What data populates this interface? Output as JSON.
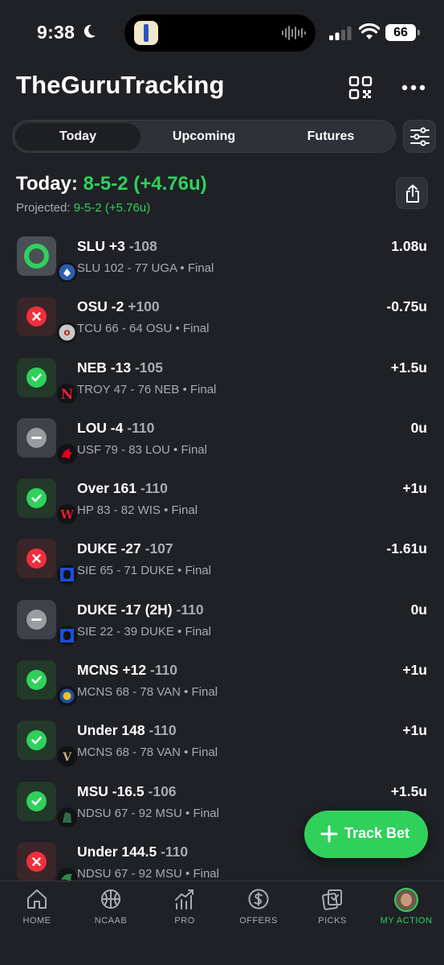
{
  "status_bar": {
    "time": "9:38",
    "battery": "66"
  },
  "header": {
    "title": "TheGuruTracking"
  },
  "tabs": [
    {
      "label": "Today",
      "active": true
    },
    {
      "label": "Upcoming",
      "active": false
    },
    {
      "label": "Futures",
      "active": false
    }
  ],
  "summary": {
    "today_label": "Today:",
    "today_record": "8-5-2 (+4.76u)",
    "projected_label": "Projected:",
    "projected_record": "9-5-2 (+5.76u)"
  },
  "bets": [
    {
      "status": "pending",
      "bet": "SLU +3",
      "odds": "-108",
      "score": "SLU 102 - 77 UGA • Final",
      "units": "1.08u",
      "team_icon": "slu-logo-icon"
    },
    {
      "status": "loss",
      "bet": "OSU -2",
      "odds": "+100",
      "score": "TCU 66 - 64 OSU • Final",
      "units": "-0.75u",
      "team_icon": "osu-logo-icon"
    },
    {
      "status": "win",
      "bet": "NEB -13",
      "odds": "-105",
      "score": "TROY 47 - 76 NEB • Final",
      "units": "+1.5u",
      "team_icon": "neb-logo-icon"
    },
    {
      "status": "push",
      "bet": "LOU -4",
      "odds": "-110",
      "score": "USF 79 - 83 LOU • Final",
      "units": "0u",
      "team_icon": "lou-logo-icon"
    },
    {
      "status": "win",
      "bet": "Over 161",
      "odds": "-110",
      "score": "HP 83 - 82 WIS • Final",
      "units": "+1u",
      "team_icon": "wis-logo-icon"
    },
    {
      "status": "loss",
      "bet": "DUKE -27",
      "odds": "-107",
      "score": "SIE 65 - 71 DUKE • Final",
      "units": "-1.61u",
      "team_icon": "duke-logo-icon"
    },
    {
      "status": "push",
      "bet": "DUKE -17 (2H)",
      "odds": "-110",
      "score": "SIE 22 - 39 DUKE • Final",
      "units": "0u",
      "team_icon": "duke-logo-icon"
    },
    {
      "status": "win",
      "bet": "MCNS +12",
      "odds": "-110",
      "score": "MCNS 68 - 78 VAN • Final",
      "units": "+1u",
      "team_icon": "mcns-logo-icon"
    },
    {
      "status": "win",
      "bet": "Under 148",
      "odds": "-110",
      "score": "MCNS 68 - 78 VAN • Final",
      "units": "+1u",
      "team_icon": "van-logo-icon"
    },
    {
      "status": "win",
      "bet": "MSU -16.5",
      "odds": "-106",
      "score": "NDSU 67 - 92 MSU • Final",
      "units": "+1.5u",
      "team_icon": "msu-logo-icon"
    },
    {
      "status": "loss",
      "bet": "Under 144.5",
      "odds": "-110",
      "score": "NDSU 67 - 92 MSU • Final",
      "units": "",
      "team_icon": "ndsu-logo-icon"
    }
  ],
  "fab": {
    "label": "Track Bet"
  },
  "nav": [
    {
      "label": "HOME",
      "icon": "home-icon",
      "active": false
    },
    {
      "label": "NCAAB",
      "icon": "basketball-icon",
      "active": false
    },
    {
      "label": "PRO",
      "icon": "pro-chart-icon",
      "active": false
    },
    {
      "label": "OFFERS",
      "icon": "dollar-coin-icon",
      "active": false
    },
    {
      "label": "PICKS",
      "icon": "picks-icon",
      "active": false
    },
    {
      "label": "MY ACTION",
      "icon": "avatar",
      "active": true
    }
  ],
  "colors": {
    "background": "#1f2126",
    "accent": "#2fd15b",
    "loss": "#ef2f3c",
    "muted": "#a9abb0"
  }
}
